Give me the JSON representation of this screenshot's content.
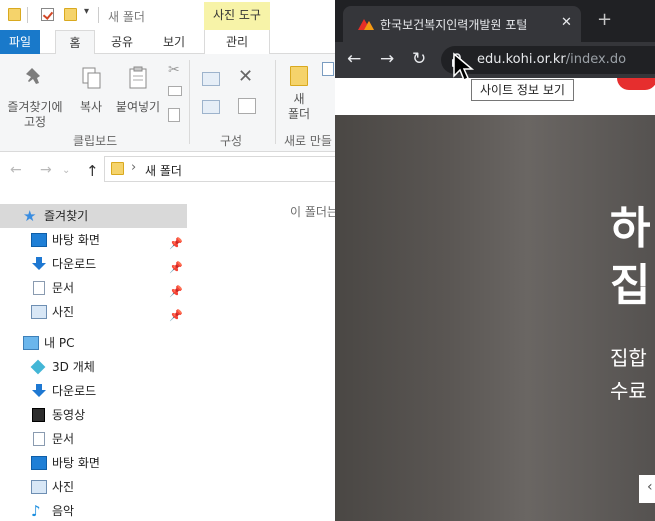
{
  "explorer": {
    "title": "새 폴더",
    "context_tab_group": "사진 도구",
    "tabs": [
      "파일",
      "홈",
      "공유",
      "보기",
      "관리"
    ],
    "ribbon": {
      "pin_label": "즐겨찾기에\n고정",
      "copy_label": "복사",
      "paste_label": "붙여넣기",
      "clipboard_group": "클립보드",
      "organize_group": "구성",
      "new_folder_label": "새\n폴더",
      "new_group": "새로 만들"
    },
    "address": {
      "path_item": "새 폴더",
      "separator": "›"
    },
    "empty_message": "이 폴더는",
    "nav": {
      "quick_access": "즐겨찾기",
      "quick_items": [
        "바탕 화면",
        "다운로드",
        "문서",
        "사진"
      ],
      "this_pc": "내 PC",
      "pc_items": [
        "3D 개체",
        "다운로드",
        "동영상",
        "문서",
        "바탕 화면",
        "사진",
        "음악"
      ]
    }
  },
  "chrome": {
    "tab_title": "한국보건복지인력개발원 포털",
    "url_host": "edu.kohi.or.kr",
    "url_path": "/index.do",
    "tooltip": "사이트 정보 보기",
    "hero": {
      "line1": "하",
      "line2": "집",
      "sub1": "집합",
      "sub2": "수료"
    }
  },
  "icons": {
    "back": "arrow-left-icon",
    "forward": "arrow-right-icon",
    "reload": "reload-icon",
    "lock": "lock-icon",
    "close": "close-icon",
    "new_tab": "plus-icon"
  }
}
